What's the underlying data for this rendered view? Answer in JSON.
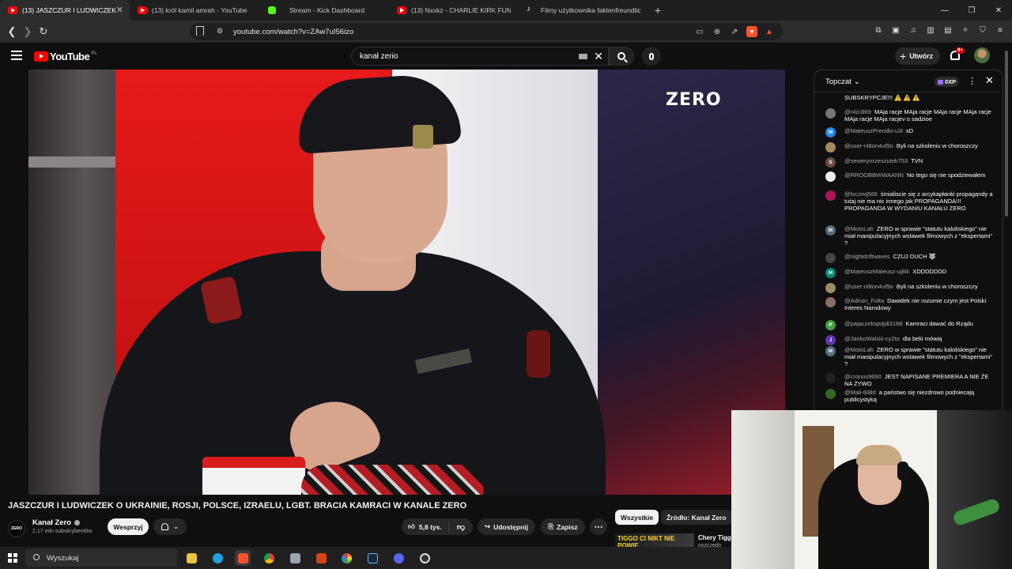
{
  "browser": {
    "tabs": [
      {
        "label": "(13) JASZCZUR I LUDWICZEK",
        "favicon": "youtube-icon",
        "active": true
      },
      {
        "label": "(13) król kamil amrah - YouTube",
        "favicon": "youtube-icon",
        "active": false
      },
      {
        "label": "Stream - Kick Dashboard",
        "favicon": "kick-icon",
        "active": false
      },
      {
        "label": "(13) Nxxkz - CHARLIE KIRK FUNK (OF",
        "favicon": "youtube-icon",
        "active": false
      },
      {
        "label": "Filmy użytkownika faktenfreundlich (",
        "favicon": "tiktok-icon",
        "active": false
      }
    ],
    "url": "youtube.com/watch?v=ZAw7uI56izo"
  },
  "youtube": {
    "logo_text": "YouTube",
    "country_code": "PL",
    "search_value": "kanał zerio",
    "create_label": "Utwórz",
    "notifications_badge": "9+"
  },
  "video": {
    "overlay_logo": "ZERO",
    "title": "JASZCZUR I LUDWICZEK O UKRAINIE, ROSJI, POLSCE, IZRAELU, LGBT. BRACIA KAMRACI W KANALE ZERO",
    "channel": {
      "name": "Kanał Zero",
      "subscribers": "2,17 mln subskrybentów",
      "avatar_text": "ZERO"
    },
    "support_label": "Wesprzyj",
    "likes": "5,8 tys.",
    "share_label": "Udostępnij",
    "save_label": "Zapisz"
  },
  "related": {
    "chips": [
      "Wszystkie",
      "Źródło: Kanał Zero"
    ],
    "first_item": {
      "thumb_text": "TIGGO CI NIKT NIE POWIE",
      "title": "Chery Tigg",
      "subtitle": "oszczędn"
    }
  },
  "chat": {
    "title": "Topczat",
    "xp": "0XP",
    "messages": [
      {
        "author": "",
        "text": "SUBSKRYPCJE!!! ⚠️ ⚠️ ⚠️",
        "avatar": "",
        "color": "#0f0f0f"
      },
      {
        "author": "@r4zi3l69",
        "text": "MAja racje MAja racje MAja racje MAja racje MAja racje MAja racjev o sadzioe",
        "avatar": "",
        "color": "#777777"
      },
      {
        "author": "@MateuszPrendki-u3i",
        "text": "xD",
        "avatar": "M",
        "color": "#1e88e5"
      },
      {
        "author": "@user-nl8on4uf9o",
        "text": "Byli na szkoleniu w choroszczy",
        "avatar": "",
        "color": "#a08a60"
      },
      {
        "author": "@sewerynrzeszutek753",
        "text": "TVN",
        "avatar": "S",
        "color": "#6d4c41"
      },
      {
        "author": "@RROOBBWWAANN",
        "text": "No tego się nie spodziewałem",
        "avatar": "",
        "color": "#eeeeee"
      },
      {
        "author": "@loczeq566",
        "text": "śmialiscie się z arcykapłanki propagandy a tutaj nie ma nic innego jak PROPAGANDA!!! PROPAGANDA W WYDANIU KANAŁU ZERO",
        "avatar": "",
        "color": "#ad1457"
      },
      {
        "author": "@MotoLah",
        "text": "ZERO w sprawie \"statutu kaloliskiego\" nie miał manipulacyjnych wstawek filmowych z \"ekspertami\" ?",
        "avatar": "M",
        "color": "#546e7a"
      },
      {
        "author": "@nightdriftwaves",
        "text": "CZUJ DUCH 🐺",
        "avatar": "",
        "color": "#444444"
      },
      {
        "author": "@MateuszMateusz-uj8ik",
        "text": "XDDDDDDD",
        "avatar": "M",
        "color": "#00897b"
      },
      {
        "author": "@user-nl8on4uf9o",
        "text": "Byli na szkoleniu w choroszczy",
        "avatar": "",
        "color": "#a08a60"
      },
      {
        "author": "@Adrian_Folta",
        "text": "Dawidek nie rozumie czym jest Polski Interes Narodowy",
        "avatar": "",
        "color": "#8d6e63"
      },
      {
        "author": "@pajaczekspajdi3188",
        "text": "Kamraci dawać do Rządu",
        "avatar": "P",
        "color": "#43a047"
      },
      {
        "author": "@JankoWalski-cy2to",
        "text": "dla beki mówią",
        "avatar": "J",
        "color": "#5e35b1"
      },
      {
        "author": "@MotoLah",
        "text": "ZERO w sprawie \"statutu kaloliskiego\" nie miał manipulacyjnych wstawek filmowych z \"ekspertami\" ?",
        "avatar": "M",
        "color": "#546e7a"
      },
      {
        "author": "@cronos9660",
        "text": "JEST NAPISANE PREMIERA A NIE ŻE NA ŻYWO",
        "avatar": "",
        "color": "#222222"
      },
      {
        "author": "@Mali-tk8ld",
        "text": "a państwo się niezdrowo podniecają publicystyką",
        "avatar": "",
        "color": "#33691e"
      }
    ]
  },
  "taskbar": {
    "search_placeholder": "Wyszukaj"
  }
}
